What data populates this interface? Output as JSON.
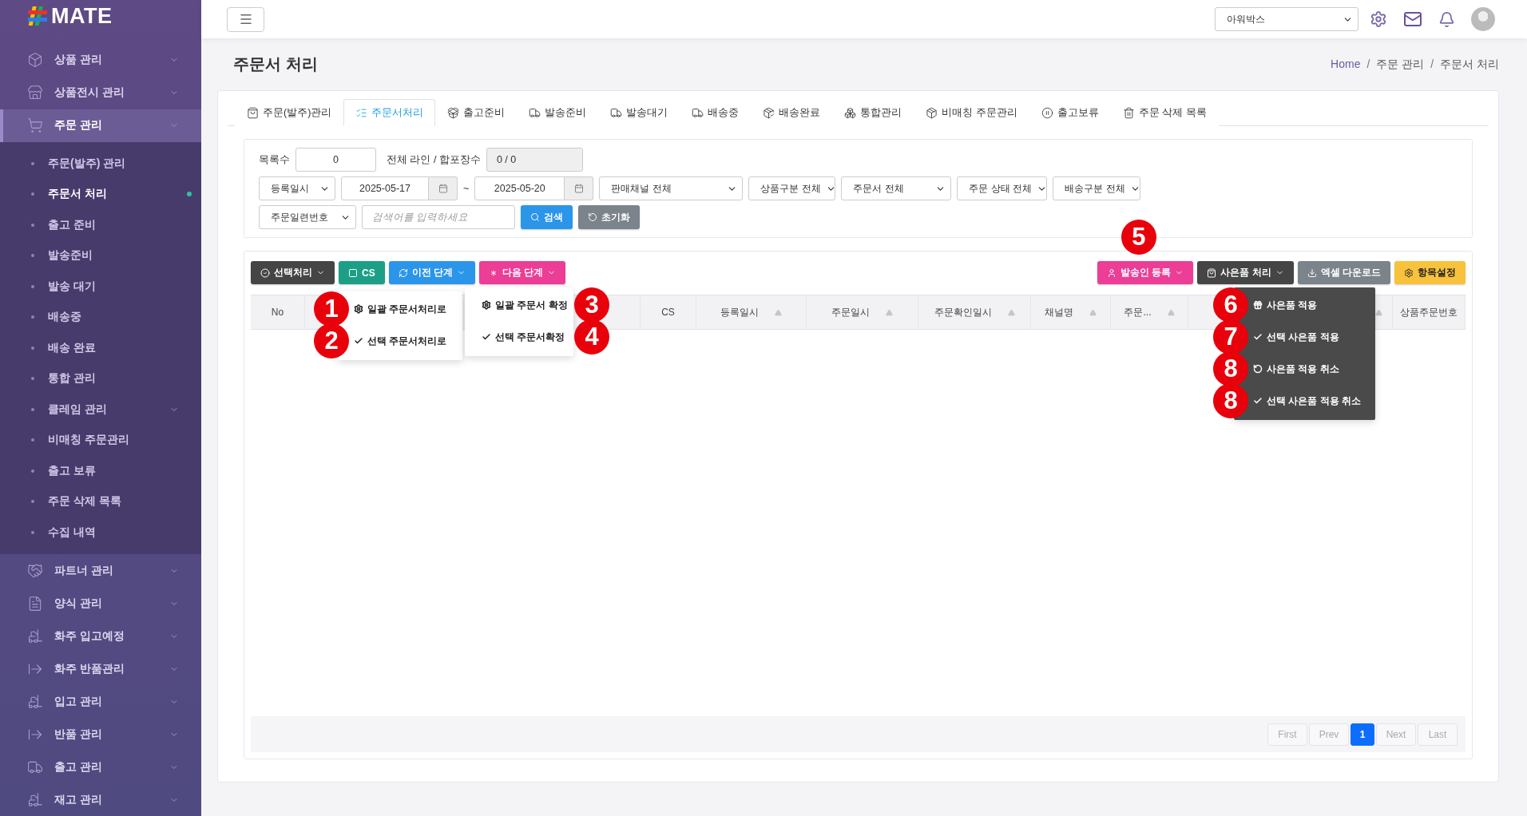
{
  "sidebar": {
    "logo": "MATE",
    "items": [
      {
        "label": "상품 관리",
        "submenu": true,
        "selected": false
      },
      {
        "label": "상품전시 관리",
        "submenu": true,
        "selected": false
      },
      {
        "label": "주문 관리",
        "submenu": true,
        "selected": true,
        "children": [
          {
            "label": "주문(발주) 관리",
            "selected": false
          },
          {
            "label": "주문서 처리",
            "selected": true
          },
          {
            "label": "출고 준비",
            "selected": false
          },
          {
            "label": "발송준비",
            "selected": false
          },
          {
            "label": "발송 대기",
            "selected": false
          },
          {
            "label": "배송중",
            "selected": false
          },
          {
            "label": "배송 완료",
            "selected": false
          },
          {
            "label": "통합 관리",
            "selected": false
          },
          {
            "label": "클레임 관리",
            "selected": false,
            "submenu": true
          },
          {
            "label": "비매칭 주문관리",
            "selected": false
          },
          {
            "label": "출고 보류",
            "selected": false
          },
          {
            "label": "주문 삭제 목록",
            "selected": false
          },
          {
            "label": "수집 내역",
            "selected": false
          }
        ]
      },
      {
        "label": "파트너 관리",
        "submenu": true,
        "selected": false
      },
      {
        "label": "양식 관리",
        "submenu": true,
        "selected": false
      },
      {
        "label": "화주 입고예정",
        "submenu": true,
        "selected": false
      },
      {
        "label": "화주 반품관리",
        "submenu": true,
        "selected": false
      },
      {
        "label": "입고 관리",
        "submenu": true,
        "selected": false
      },
      {
        "label": "반품 관리",
        "submenu": true,
        "selected": false
      },
      {
        "label": "출고 관리",
        "submenu": true,
        "selected": false
      },
      {
        "label": "재고 관리",
        "submenu": true,
        "selected": false
      }
    ]
  },
  "topbar": {
    "company_select": "아워박스"
  },
  "page": {
    "title": "주문서 처리",
    "breadcrumb": [
      "Home",
      "주문 관리",
      "주문서 처리"
    ],
    "breadcrumb_separator": "/"
  },
  "tabs": [
    {
      "label": "주문(발주)관리",
      "selected": false
    },
    {
      "label": "주문서처리",
      "selected": true
    },
    {
      "label": "출고준비",
      "selected": false
    },
    {
      "label": "발송준비",
      "selected": false
    },
    {
      "label": "발송대기",
      "selected": false
    },
    {
      "label": "배송중",
      "selected": false
    },
    {
      "label": "배송완료",
      "selected": false
    },
    {
      "label": "통합관리",
      "selected": false
    },
    {
      "label": "비매칭 주문관리",
      "selected": false
    },
    {
      "label": "출고보류",
      "selected": false
    },
    {
      "label": "주문 삭제 목록",
      "selected": false
    }
  ],
  "filters": {
    "count_label": "목록수",
    "count_value": "0",
    "lines_label": "전체 라인 / 합포장수",
    "lines_value": "0 / 0",
    "date_type": "등록일시",
    "date_from": "2025-05-17",
    "date_sep": "~",
    "date_to": "2025-05-20",
    "selects": [
      "판매채널 전체",
      "상품구분 전체",
      "주문서 전체",
      "주문 상태 전체",
      "배송구분 전체"
    ],
    "search_type": "주문일련번호",
    "search_placeholder": "검색어를 입력하세요",
    "search_button": "검색",
    "reset_button": "초기화"
  },
  "toolbar": {
    "left": [
      {
        "label": "선택처리",
        "kind": "dark",
        "dropdown": true
      },
      {
        "label": "CS",
        "kind": "teal",
        "dropdown": false
      },
      {
        "label": "이전 단계",
        "kind": "blue",
        "dropdown": true
      },
      {
        "label": "다음 단계",
        "kind": "pink",
        "dropdown": true
      }
    ],
    "right": [
      {
        "label": "발송인 등록",
        "kind": "pink",
        "dropdown": true,
        "annotation": "5"
      },
      {
        "label": "사은품 처리",
        "kind": "dark",
        "dropdown": true
      },
      {
        "label": "엑셀 다운로드",
        "kind": "gray",
        "dropdown": false
      },
      {
        "label": "항목설정",
        "kind": "yellow",
        "dropdown": false
      }
    ]
  },
  "table": {
    "columns": [
      {
        "label": "No",
        "sortable": false
      },
      {
        "sortable": false
      },
      {
        "label": "CS",
        "sortable": false
      },
      {
        "label": "등록일시",
        "sortable": true
      },
      {
        "label": "주문일시",
        "sortable": true
      },
      {
        "label": "주문확인일시",
        "sortable": true
      },
      {
        "label": "채널명",
        "sortable": true
      },
      {
        "label": "주문...",
        "sortable": true
      },
      {
        "sortable": true
      },
      {
        "label": "상품주문번호",
        "sortable": false
      }
    ]
  },
  "menus": [
    {
      "kind": "light",
      "items": [
        {
          "label": "일괄 주문서처리로",
          "annotation": "1"
        },
        {
          "label": "선택 주문서처리로",
          "annotation": "2"
        }
      ]
    },
    {
      "kind": "light",
      "items": [
        {
          "label": "일괄 주문서 확정",
          "annotation": "3"
        },
        {
          "label": "선택 주문서확정",
          "annotation": "4"
        }
      ]
    },
    {
      "kind": "dark",
      "items": [
        {
          "label": "사은품 적용",
          "annotation": "6"
        },
        {
          "label": "선택 사은품 적용",
          "annotation": "7"
        },
        {
          "label": "사은품 적용 취소",
          "annotation": "8"
        },
        {
          "label": "선택 사은품 적용 취소",
          "annotation": "8"
        }
      ]
    }
  ],
  "pagination": [
    {
      "label": "First",
      "selected": false
    },
    {
      "label": "Prev",
      "selected": false
    },
    {
      "label": "1",
      "selected": true
    },
    {
      "label": "Next",
      "selected": false
    },
    {
      "label": "Last",
      "selected": false
    }
  ]
}
